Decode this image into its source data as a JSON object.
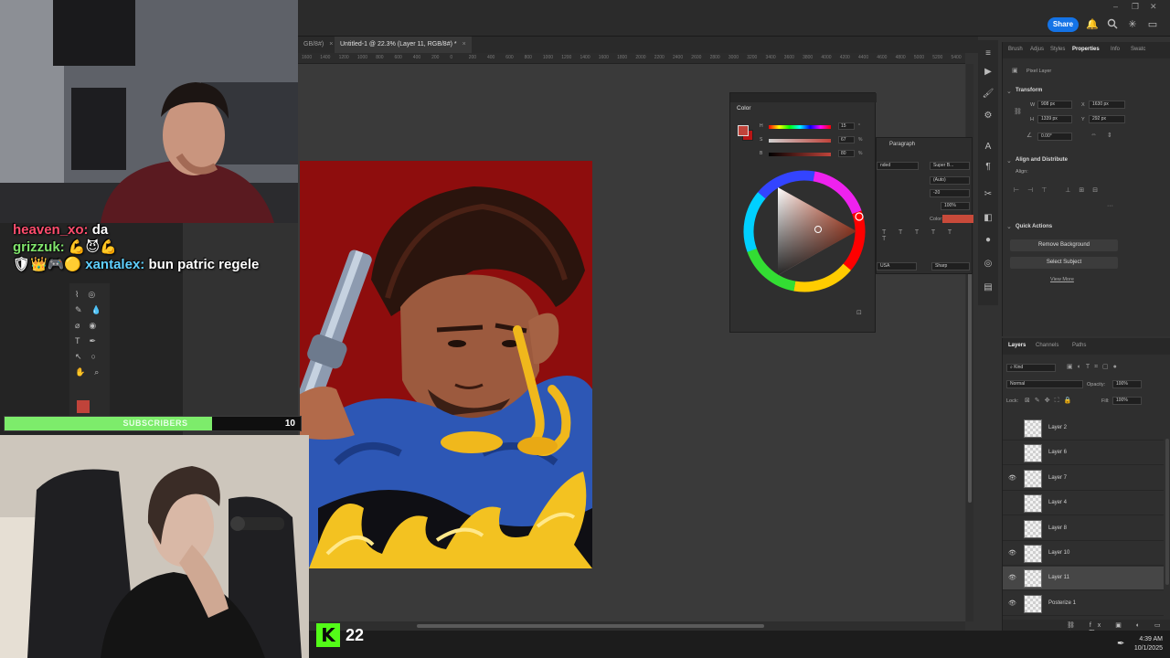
{
  "app": {
    "share_label": "Share",
    "window_controls": [
      "–",
      "❐",
      "✕"
    ]
  },
  "document_tabs": [
    {
      "label": "GB/8#)",
      "active": false
    },
    {
      "label": "Untitled-1 @ 22.3% (Layer 11, RGB/8#) *",
      "active": true
    }
  ],
  "ruler_ticks": [
    "1600",
    "1400",
    "1200",
    "1000",
    "800",
    "600",
    "400",
    "200",
    "0",
    "200",
    "400",
    "600",
    "800",
    "1000",
    "1200",
    "1400",
    "1600",
    "1800",
    "2000",
    "2200",
    "2400",
    "2600",
    "2800",
    "3000",
    "3200",
    "3400",
    "3600",
    "3800",
    "4000",
    "4200",
    "4400",
    "4600",
    "4800",
    "5000",
    "5200",
    "5400"
  ],
  "properties": {
    "tabs": [
      "Brush",
      "Adjus",
      "Styles",
      "Properties",
      "Info",
      "Swatc"
    ],
    "active_tab": "Properties",
    "layer_type": "Pixel Layer",
    "transform_title": "Transform",
    "w_label": "W",
    "w_value": "908 px",
    "h_label": "H",
    "h_value": "1339 px",
    "x_label": "X",
    "x_value": "1630 px",
    "y_label": "Y",
    "y_value": "292 px",
    "angle_value": "0.00°",
    "align_title": "Align and Distribute",
    "align_label": "Align:",
    "quick_actions_title": "Quick Actions",
    "remove_bg_label": "Remove Background",
    "select_subject_label": "Select Subject",
    "view_more_label": "View More"
  },
  "color_panel": {
    "title": "Color",
    "foreground": "#c0433a",
    "background": "#b81515",
    "sliders": [
      {
        "label": "H",
        "value": "15",
        "unit": "°"
      },
      {
        "label": "S",
        "value": "67",
        "unit": "%"
      },
      {
        "label": "B",
        "value": "80",
        "unit": "%"
      }
    ]
  },
  "paragraph_panel": {
    "title": "Paragraph",
    "font_style": "Super B...",
    "anti_alias": "Sharp",
    "leading": "(Auto)",
    "tracking": "-20",
    "scale": "100%",
    "color_label": "Color:",
    "language": "USA",
    "blend_hint": "nded",
    "color_swatch": "#c84a3a"
  },
  "layers": {
    "tabs": [
      "Layers",
      "Channels",
      "Paths"
    ],
    "active_tab": "Layers",
    "kind_label": "Kind",
    "blend_mode": "Normal",
    "opacity_label": "Opacity:",
    "opacity_value": "100%",
    "lock_label": "Lock:",
    "fill_label": "Fill:",
    "fill_value": "100%",
    "items": [
      {
        "name": "Layer 2",
        "visible": false,
        "selected": false
      },
      {
        "name": "Layer 6",
        "visible": false,
        "selected": false
      },
      {
        "name": "Layer 7",
        "visible": true,
        "selected": false
      },
      {
        "name": "Layer 4",
        "visible": false,
        "selected": false
      },
      {
        "name": "Layer 8",
        "visible": false,
        "selected": false
      },
      {
        "name": "Layer 10",
        "visible": true,
        "selected": false
      },
      {
        "name": "Layer 11",
        "visible": true,
        "selected": true
      },
      {
        "name": "Posterize 1",
        "visible": true,
        "selected": false
      }
    ]
  },
  "chat": [
    {
      "user": "heaven_xo:",
      "message": "da"
    },
    {
      "user": "grizzuk:",
      "message": "💪😈💪"
    },
    {
      "user": "xantalex:",
      "message": "bun patric regele"
    }
  ],
  "subscribers": {
    "label": "SUBSCRIBERS",
    "count": "10",
    "progress": 0.7
  },
  "kick": {
    "logo": "K",
    "viewers": "22"
  },
  "taskbar": {
    "time": "4:39 AM",
    "date": "10/1/2025"
  }
}
